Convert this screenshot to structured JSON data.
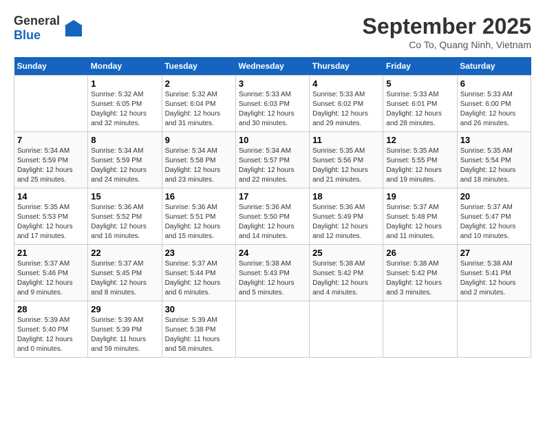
{
  "header": {
    "logo_general": "General",
    "logo_blue": "Blue",
    "month": "September 2025",
    "location": "Co To, Quang Ninh, Vietnam"
  },
  "days_of_week": [
    "Sunday",
    "Monday",
    "Tuesday",
    "Wednesday",
    "Thursday",
    "Friday",
    "Saturday"
  ],
  "weeks": [
    [
      {
        "day": "",
        "sunrise": "",
        "sunset": "",
        "daylight": ""
      },
      {
        "day": "1",
        "sunrise": "Sunrise: 5:32 AM",
        "sunset": "Sunset: 6:05 PM",
        "daylight": "Daylight: 12 hours and 32 minutes."
      },
      {
        "day": "2",
        "sunrise": "Sunrise: 5:32 AM",
        "sunset": "Sunset: 6:04 PM",
        "daylight": "Daylight: 12 hours and 31 minutes."
      },
      {
        "day": "3",
        "sunrise": "Sunrise: 5:33 AM",
        "sunset": "Sunset: 6:03 PM",
        "daylight": "Daylight: 12 hours and 30 minutes."
      },
      {
        "day": "4",
        "sunrise": "Sunrise: 5:33 AM",
        "sunset": "Sunset: 6:02 PM",
        "daylight": "Daylight: 12 hours and 29 minutes."
      },
      {
        "day": "5",
        "sunrise": "Sunrise: 5:33 AM",
        "sunset": "Sunset: 6:01 PM",
        "daylight": "Daylight: 12 hours and 28 minutes."
      },
      {
        "day": "6",
        "sunrise": "Sunrise: 5:33 AM",
        "sunset": "Sunset: 6:00 PM",
        "daylight": "Daylight: 12 hours and 26 minutes."
      }
    ],
    [
      {
        "day": "7",
        "sunrise": "Sunrise: 5:34 AM",
        "sunset": "Sunset: 5:59 PM",
        "daylight": "Daylight: 12 hours and 25 minutes."
      },
      {
        "day": "8",
        "sunrise": "Sunrise: 5:34 AM",
        "sunset": "Sunset: 5:59 PM",
        "daylight": "Daylight: 12 hours and 24 minutes."
      },
      {
        "day": "9",
        "sunrise": "Sunrise: 5:34 AM",
        "sunset": "Sunset: 5:58 PM",
        "daylight": "Daylight: 12 hours and 23 minutes."
      },
      {
        "day": "10",
        "sunrise": "Sunrise: 5:34 AM",
        "sunset": "Sunset: 5:57 PM",
        "daylight": "Daylight: 12 hours and 22 minutes."
      },
      {
        "day": "11",
        "sunrise": "Sunrise: 5:35 AM",
        "sunset": "Sunset: 5:56 PM",
        "daylight": "Daylight: 12 hours and 21 minutes."
      },
      {
        "day": "12",
        "sunrise": "Sunrise: 5:35 AM",
        "sunset": "Sunset: 5:55 PM",
        "daylight": "Daylight: 12 hours and 19 minutes."
      },
      {
        "day": "13",
        "sunrise": "Sunrise: 5:35 AM",
        "sunset": "Sunset: 5:54 PM",
        "daylight": "Daylight: 12 hours and 18 minutes."
      }
    ],
    [
      {
        "day": "14",
        "sunrise": "Sunrise: 5:35 AM",
        "sunset": "Sunset: 5:53 PM",
        "daylight": "Daylight: 12 hours and 17 minutes."
      },
      {
        "day": "15",
        "sunrise": "Sunrise: 5:36 AM",
        "sunset": "Sunset: 5:52 PM",
        "daylight": "Daylight: 12 hours and 16 minutes."
      },
      {
        "day": "16",
        "sunrise": "Sunrise: 5:36 AM",
        "sunset": "Sunset: 5:51 PM",
        "daylight": "Daylight: 12 hours and 15 minutes."
      },
      {
        "day": "17",
        "sunrise": "Sunrise: 5:36 AM",
        "sunset": "Sunset: 5:50 PM",
        "daylight": "Daylight: 12 hours and 14 minutes."
      },
      {
        "day": "18",
        "sunrise": "Sunrise: 5:36 AM",
        "sunset": "Sunset: 5:49 PM",
        "daylight": "Daylight: 12 hours and 12 minutes."
      },
      {
        "day": "19",
        "sunrise": "Sunrise: 5:37 AM",
        "sunset": "Sunset: 5:48 PM",
        "daylight": "Daylight: 12 hours and 11 minutes."
      },
      {
        "day": "20",
        "sunrise": "Sunrise: 5:37 AM",
        "sunset": "Sunset: 5:47 PM",
        "daylight": "Daylight: 12 hours and 10 minutes."
      }
    ],
    [
      {
        "day": "21",
        "sunrise": "Sunrise: 5:37 AM",
        "sunset": "Sunset: 5:46 PM",
        "daylight": "Daylight: 12 hours and 9 minutes."
      },
      {
        "day": "22",
        "sunrise": "Sunrise: 5:37 AM",
        "sunset": "Sunset: 5:45 PM",
        "daylight": "Daylight: 12 hours and 8 minutes."
      },
      {
        "day": "23",
        "sunrise": "Sunrise: 5:37 AM",
        "sunset": "Sunset: 5:44 PM",
        "daylight": "Daylight: 12 hours and 6 minutes."
      },
      {
        "day": "24",
        "sunrise": "Sunrise: 5:38 AM",
        "sunset": "Sunset: 5:43 PM",
        "daylight": "Daylight: 12 hours and 5 minutes."
      },
      {
        "day": "25",
        "sunrise": "Sunrise: 5:38 AM",
        "sunset": "Sunset: 5:42 PM",
        "daylight": "Daylight: 12 hours and 4 minutes."
      },
      {
        "day": "26",
        "sunrise": "Sunrise: 5:38 AM",
        "sunset": "Sunset: 5:42 PM",
        "daylight": "Daylight: 12 hours and 3 minutes."
      },
      {
        "day": "27",
        "sunrise": "Sunrise: 5:38 AM",
        "sunset": "Sunset: 5:41 PM",
        "daylight": "Daylight: 12 hours and 2 minutes."
      }
    ],
    [
      {
        "day": "28",
        "sunrise": "Sunrise: 5:39 AM",
        "sunset": "Sunset: 5:40 PM",
        "daylight": "Daylight: 12 hours and 0 minutes."
      },
      {
        "day": "29",
        "sunrise": "Sunrise: 5:39 AM",
        "sunset": "Sunset: 5:39 PM",
        "daylight": "Daylight: 11 hours and 59 minutes."
      },
      {
        "day": "30",
        "sunrise": "Sunrise: 5:39 AM",
        "sunset": "Sunset: 5:38 PM",
        "daylight": "Daylight: 11 hours and 58 minutes."
      },
      {
        "day": "",
        "sunrise": "",
        "sunset": "",
        "daylight": ""
      },
      {
        "day": "",
        "sunrise": "",
        "sunset": "",
        "daylight": ""
      },
      {
        "day": "",
        "sunrise": "",
        "sunset": "",
        "daylight": ""
      },
      {
        "day": "",
        "sunrise": "",
        "sunset": "",
        "daylight": ""
      }
    ]
  ]
}
